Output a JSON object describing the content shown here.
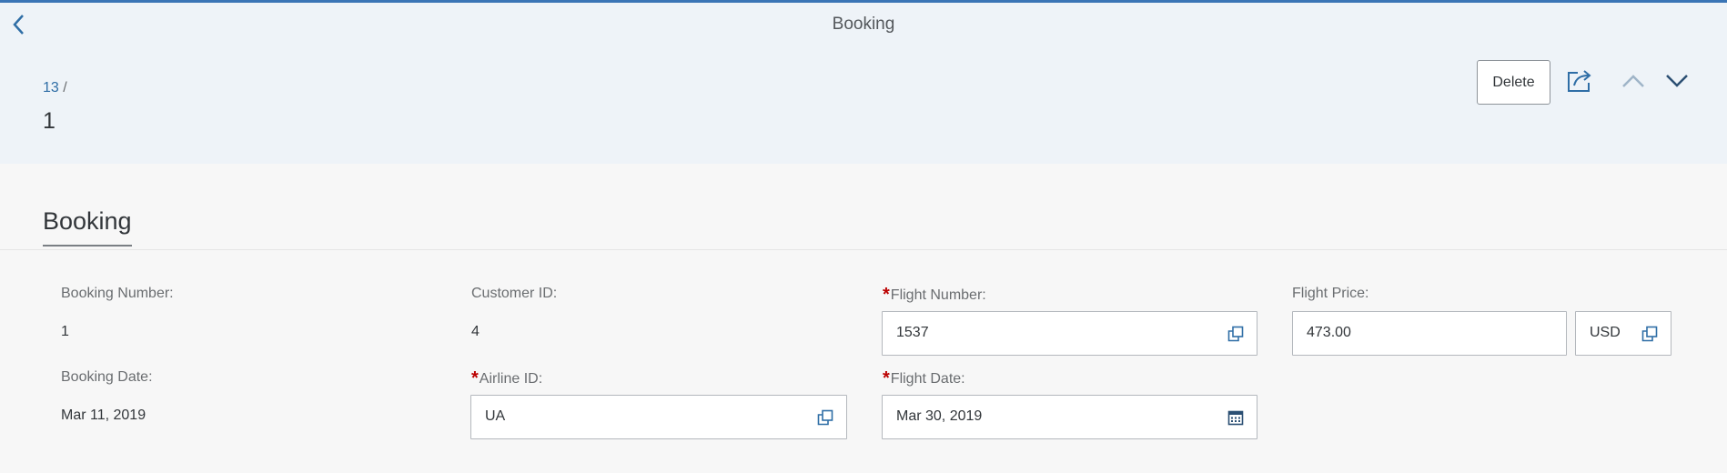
{
  "shell": {
    "title": "Booking",
    "back_icon": "chevron-left-icon"
  },
  "header": {
    "breadcrumb_link": "13",
    "breadcrumb_sep": "/",
    "title": "1",
    "delete_label": "Delete",
    "share_icon": "share-icon",
    "prev_icon": "chevron-up-icon",
    "next_icon": "chevron-down-icon"
  },
  "section": {
    "tab_label": "Booking"
  },
  "form": {
    "booking_number": {
      "label": "Booking Number:",
      "value": "1"
    },
    "customer_id": {
      "label": "Customer ID:",
      "value": "4"
    },
    "flight_number": {
      "required": "*",
      "label": "Flight Number:",
      "value": "1537",
      "icon": "value-help-icon"
    },
    "flight_price": {
      "label": "Flight Price:",
      "value": "473.00",
      "currency": "USD",
      "icon": "value-help-icon"
    },
    "booking_date": {
      "label": "Booking Date:",
      "value": "Mar 11, 2019"
    },
    "airline_id": {
      "required": "*",
      "label": "Airline ID:",
      "value": "UA",
      "icon": "value-help-icon"
    },
    "flight_date": {
      "required": "*",
      "label": "Flight Date:",
      "value": "Mar 30, 2019",
      "icon": "calendar-icon"
    }
  },
  "colors": {
    "accent": "#3a75b6",
    "header_bg": "#eef3f8",
    "page_bg": "#f7f7f7",
    "required": "#bb0000",
    "link": "#2f6ea6"
  }
}
